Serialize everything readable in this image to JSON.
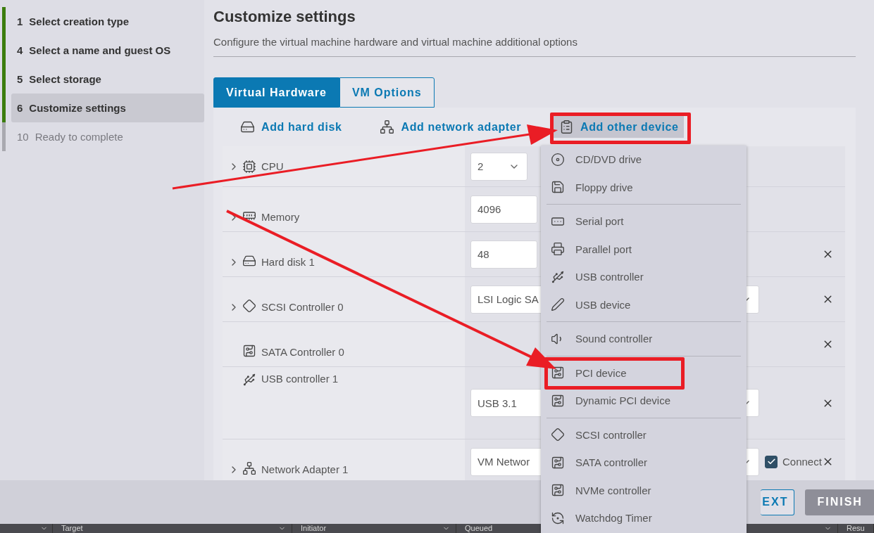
{
  "sidebar": {
    "steps": [
      {
        "number": "1",
        "label": "Select creation type",
        "completed": true,
        "selected": false
      },
      {
        "number": "4",
        "label": "Select a name and guest OS",
        "completed": true,
        "selected": false
      },
      {
        "number": "5",
        "label": "Select storage",
        "completed": true,
        "selected": false
      },
      {
        "number": "6",
        "label": "Customize settings",
        "completed": true,
        "selected": true
      },
      {
        "number": "10",
        "label": "Ready to complete",
        "completed": false,
        "selected": false
      }
    ]
  },
  "page": {
    "title": "Customize settings",
    "subtitle": "Configure the virtual machine hardware and virtual machine additional options"
  },
  "tabs": [
    {
      "label": "Virtual Hardware",
      "selected": true
    },
    {
      "label": "VM Options",
      "selected": false
    }
  ],
  "toolbar": [
    {
      "label": "Add hard disk",
      "kind": "disk",
      "active": false,
      "highlighted": false
    },
    {
      "label": "Add network adapter",
      "kind": "network",
      "active": false,
      "highlighted": false
    },
    {
      "label": "Add other device",
      "kind": "other",
      "active": true,
      "highlighted": true
    }
  ],
  "hardware": [
    {
      "label": "CPU",
      "kind": "cpu",
      "expandable": true,
      "removable": false,
      "field": {
        "kind": "select-small",
        "value": "2"
      }
    },
    {
      "label": "Memory",
      "kind": "memory",
      "expandable": true,
      "removable": false,
      "field": {
        "kind": "input",
        "value": "4096"
      }
    },
    {
      "label": "Hard disk 1",
      "kind": "disk",
      "expandable": true,
      "removable": true,
      "field": {
        "kind": "input",
        "value": "48"
      }
    },
    {
      "label": "SCSI Controller 0",
      "kind": "scsi",
      "expandable": true,
      "removable": true,
      "field": {
        "kind": "select",
        "value": "LSI Logic SA"
      }
    },
    {
      "label": "SATA Controller 0",
      "kind": "sata",
      "expandable": false,
      "removable": true
    },
    {
      "label": "USB controller 1",
      "kind": "usb",
      "expandable": false,
      "removable": true,
      "field": {
        "kind": "select",
        "value": "USB 3.1"
      }
    },
    {
      "label": "Network Adapter 1",
      "kind": "network",
      "expandable": true,
      "removable": true,
      "field": {
        "kind": "select",
        "value": "VM Networ"
      },
      "connect": {
        "label": "Connect",
        "checked": true
      }
    }
  ],
  "menu": {
    "groups": [
      [
        {
          "label": "CD/DVD drive",
          "kind": "cdrom",
          "highlighted": false
        },
        {
          "label": "Floppy drive",
          "kind": "floppy",
          "highlighted": false
        }
      ],
      [
        {
          "label": "Serial port",
          "kind": "serial",
          "highlighted": false
        },
        {
          "label": "Parallel port",
          "kind": "parallel",
          "highlighted": false
        },
        {
          "label": "USB controller",
          "kind": "usb",
          "highlighted": false
        },
        {
          "label": "USB device",
          "kind": "usb-device",
          "highlighted": false
        }
      ],
      [
        {
          "label": "Sound controller",
          "kind": "sound",
          "highlighted": false
        }
      ],
      [
        {
          "label": "PCI device",
          "kind": "pci",
          "highlighted": true
        },
        {
          "label": "Dynamic PCI device",
          "kind": "pci",
          "highlighted": false
        }
      ],
      [
        {
          "label": "SCSI controller",
          "kind": "scsi",
          "highlighted": false
        },
        {
          "label": "SATA controller",
          "kind": "sata",
          "highlighted": false
        },
        {
          "label": "NVMe controller",
          "kind": "nvme",
          "highlighted": false
        },
        {
          "label": "Watchdog Timer",
          "kind": "watchdog",
          "highlighted": false
        }
      ]
    ]
  },
  "footer": {
    "buttons": [
      {
        "label": "EXT",
        "disabled": false
      },
      {
        "label": "FINISH",
        "disabled": true
      }
    ]
  },
  "task_table": {
    "columns": [
      {
        "label": "Target"
      },
      {
        "label": "Initiator"
      },
      {
        "label": "Queued"
      },
      {
        "label": "Resu"
      }
    ]
  }
}
